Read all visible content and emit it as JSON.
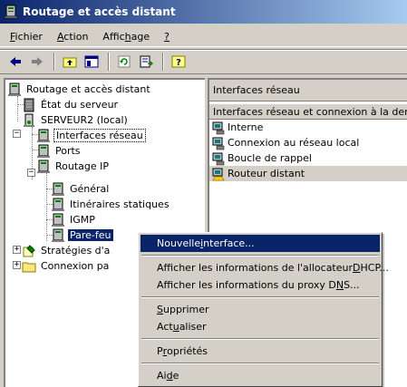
{
  "window": {
    "title": "Routage et accès distant",
    "icon": "server-icon"
  },
  "menubar": {
    "items": [
      {
        "pre": "",
        "u": "F",
        "post": "ichier"
      },
      {
        "pre": "",
        "u": "A",
        "post": "ction"
      },
      {
        "pre": "Affic",
        "u": "h",
        "post": "age"
      },
      {
        "pre": "",
        "u": "?",
        "post": ""
      }
    ]
  },
  "toolbar": {
    "icons": [
      "back-arrow-icon",
      "forward-arrow-icon",
      "up-folder-icon",
      "show-hide-tree-icon",
      "refresh-icon",
      "export-list-icon",
      "help-icon"
    ]
  },
  "tree": {
    "root": "Routage et accès distant",
    "server_status": "État du serveur",
    "server": "SERVEUR2 (local)",
    "interfaces": "Interfaces réseau",
    "ports": "Ports",
    "routing_ip": "Routage IP",
    "general": "Général",
    "static_routes": "Itinéraires statiques",
    "igmp": "IGMP",
    "firewall": "Pare-feu",
    "policies": "Stratégies d'a",
    "logging": "Connexion pa"
  },
  "rightpane": {
    "title": "Interfaces réseau",
    "column_header": "Interfaces réseau et connexion à la demande",
    "items": [
      "Interne",
      "Connexion au réseau local",
      "Boucle de rappel",
      "Routeur distant"
    ]
  },
  "context_menu": {
    "new_interface": {
      "pre": "Nouvelle ",
      "u": "i",
      "post": "nterface..."
    },
    "dhcp": {
      "pre": "Afficher les informations de l'allocateur ",
      "u": "D",
      "post": "HCP..."
    },
    "dns": {
      "pre": "Afficher les informations du proxy D",
      "u": "N",
      "post": "S..."
    },
    "delete": {
      "pre": "",
      "u": "S",
      "post": "upprimer"
    },
    "refresh": {
      "pre": "Act",
      "u": "u",
      "post": "aliser"
    },
    "properties": {
      "pre": "P",
      "u": "r",
      "post": "opriétés"
    },
    "help": {
      "pre": "Ai",
      "u": "d",
      "post": "e"
    }
  },
  "colors": {
    "selection": "#0a246a",
    "title_start": "#0a246a",
    "title_end": "#a6caf0",
    "face": "#d4d0c8"
  }
}
